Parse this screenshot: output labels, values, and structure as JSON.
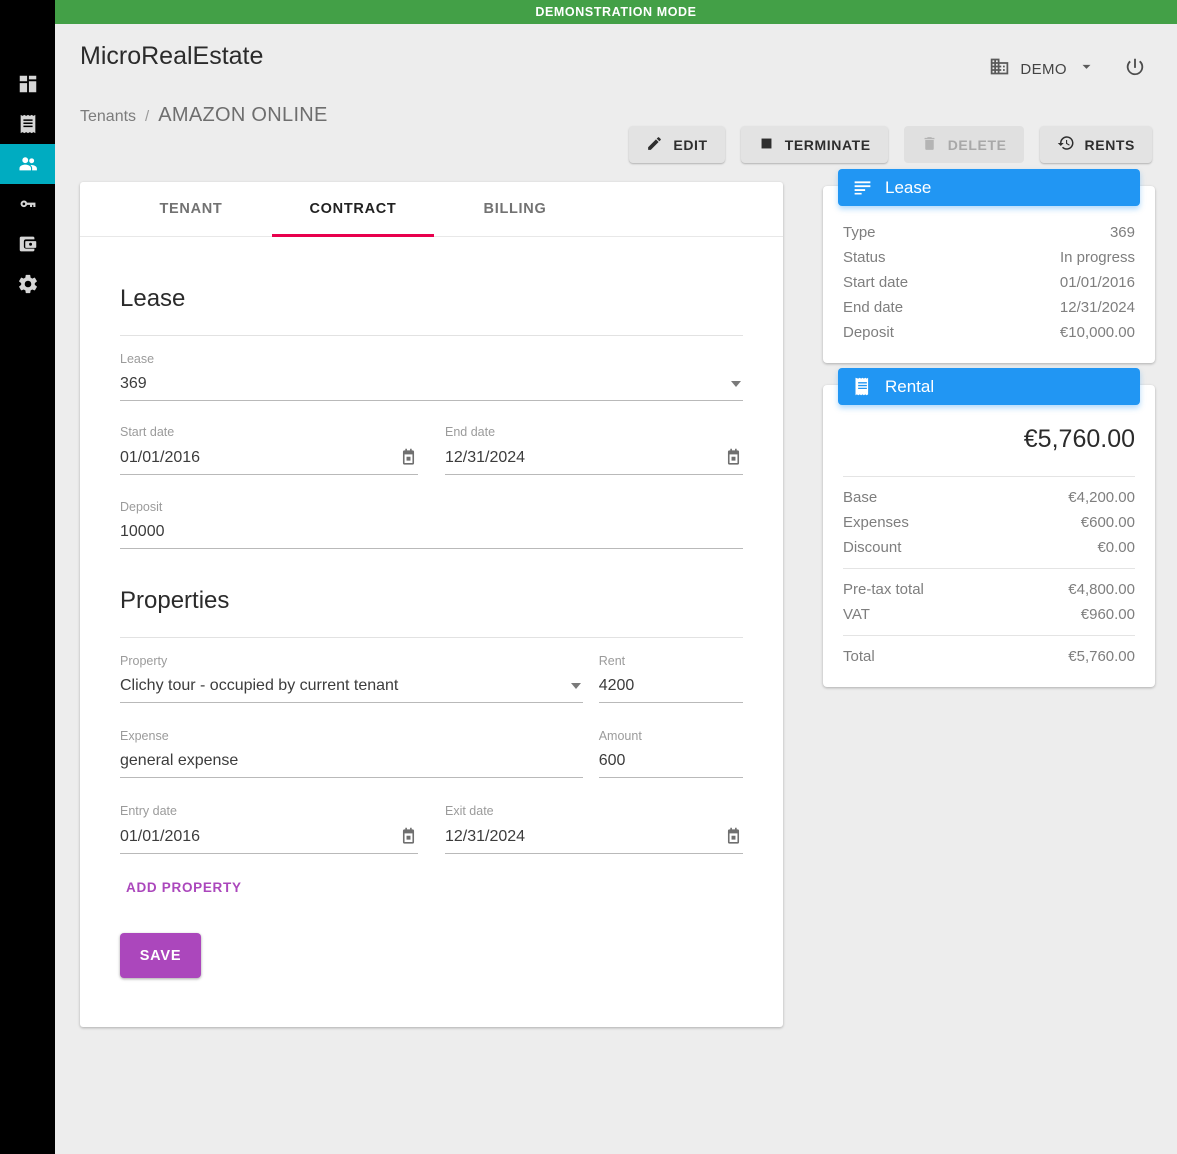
{
  "banner": {
    "text": "DEMONSTRATION MODE",
    "color": "#43a047"
  },
  "sidebar": {
    "items": [
      {
        "name": "dashboard",
        "icon": "dashboard-icon",
        "active": false
      },
      {
        "name": "rents",
        "icon": "receipt-icon",
        "active": false
      },
      {
        "name": "tenants",
        "icon": "people-icon",
        "active": true
      },
      {
        "name": "properties",
        "icon": "key-icon",
        "active": false
      },
      {
        "name": "accounting",
        "icon": "wallet-icon",
        "active": false
      },
      {
        "name": "settings",
        "icon": "gear-icon",
        "active": false
      }
    ],
    "active_color": "#00acc1"
  },
  "header": {
    "brand": "MicroRealEstate",
    "organization": "DEMO",
    "org_icon": "building-icon",
    "chevron_icon": "chevron-down-icon",
    "power_icon": "power-icon"
  },
  "breadcrumb": {
    "root": "Tenants",
    "separator": "/",
    "current": "AMAZON ONLINE"
  },
  "actions": [
    {
      "label": "EDIT",
      "icon": "pencil-icon",
      "disabled": false
    },
    {
      "label": "TERMINATE",
      "icon": "stop-square-icon",
      "disabled": false
    },
    {
      "label": "DELETE",
      "icon": "trash-icon",
      "disabled": true
    },
    {
      "label": "RENTS",
      "icon": "history-icon",
      "disabled": false
    }
  ],
  "tabs": [
    {
      "label": "TENANT",
      "active": false
    },
    {
      "label": "CONTRACT",
      "active": true
    },
    {
      "label": "BILLING",
      "active": false
    }
  ],
  "tab_accent": "#e8004d",
  "form": {
    "lease_section_title": "Lease",
    "lease_field": {
      "label": "Lease",
      "value": "369",
      "control": "select"
    },
    "start_date": {
      "label": "Start date",
      "value": "01/01/2016",
      "icon": "calendar-icon"
    },
    "end_date": {
      "label": "End date",
      "value": "12/31/2024",
      "icon": "calendar-icon"
    },
    "deposit": {
      "label": "Deposit",
      "value": "10000"
    },
    "properties_section_title": "Properties",
    "property": {
      "label": "Property",
      "value": "Clichy tour - occupied by current tenant",
      "control": "select"
    },
    "rent": {
      "label": "Rent",
      "value": "4200"
    },
    "expense": {
      "label": "Expense",
      "value": "general expense"
    },
    "amount": {
      "label": "Amount",
      "value": "600"
    },
    "entry_date": {
      "label": "Entry date",
      "value": "01/01/2016",
      "icon": "calendar-icon"
    },
    "exit_date": {
      "label": "Exit date",
      "value": "12/31/2024",
      "icon": "calendar-icon"
    },
    "add_property_label": "ADD PROPERTY",
    "save_label": "SAVE",
    "accent_purple": "#ab47bc"
  },
  "lease_card": {
    "title": "Lease",
    "icon": "subject-icon",
    "header_color": "#2196f3",
    "rows": [
      {
        "key": "Type",
        "value": "369"
      },
      {
        "key": "Status",
        "value": "In progress"
      },
      {
        "key": "Start date",
        "value": "01/01/2016"
      },
      {
        "key": "End date",
        "value": "12/31/2024"
      },
      {
        "key": "Deposit",
        "value": "€10,000.00"
      }
    ]
  },
  "rental_card": {
    "title": "Rental",
    "icon": "receipt-icon",
    "header_color": "#2196f3",
    "total_big": "€5,760.00",
    "group1": [
      {
        "key": "Base",
        "value": "€4,200.00"
      },
      {
        "key": "Expenses",
        "value": "€600.00"
      },
      {
        "key": "Discount",
        "value": "€0.00"
      }
    ],
    "group2": [
      {
        "key": "Pre-tax total",
        "value": "€4,800.00"
      },
      {
        "key": "VAT",
        "value": "€960.00"
      }
    ],
    "group3": [
      {
        "key": "Total",
        "value": "€5,760.00"
      }
    ]
  }
}
